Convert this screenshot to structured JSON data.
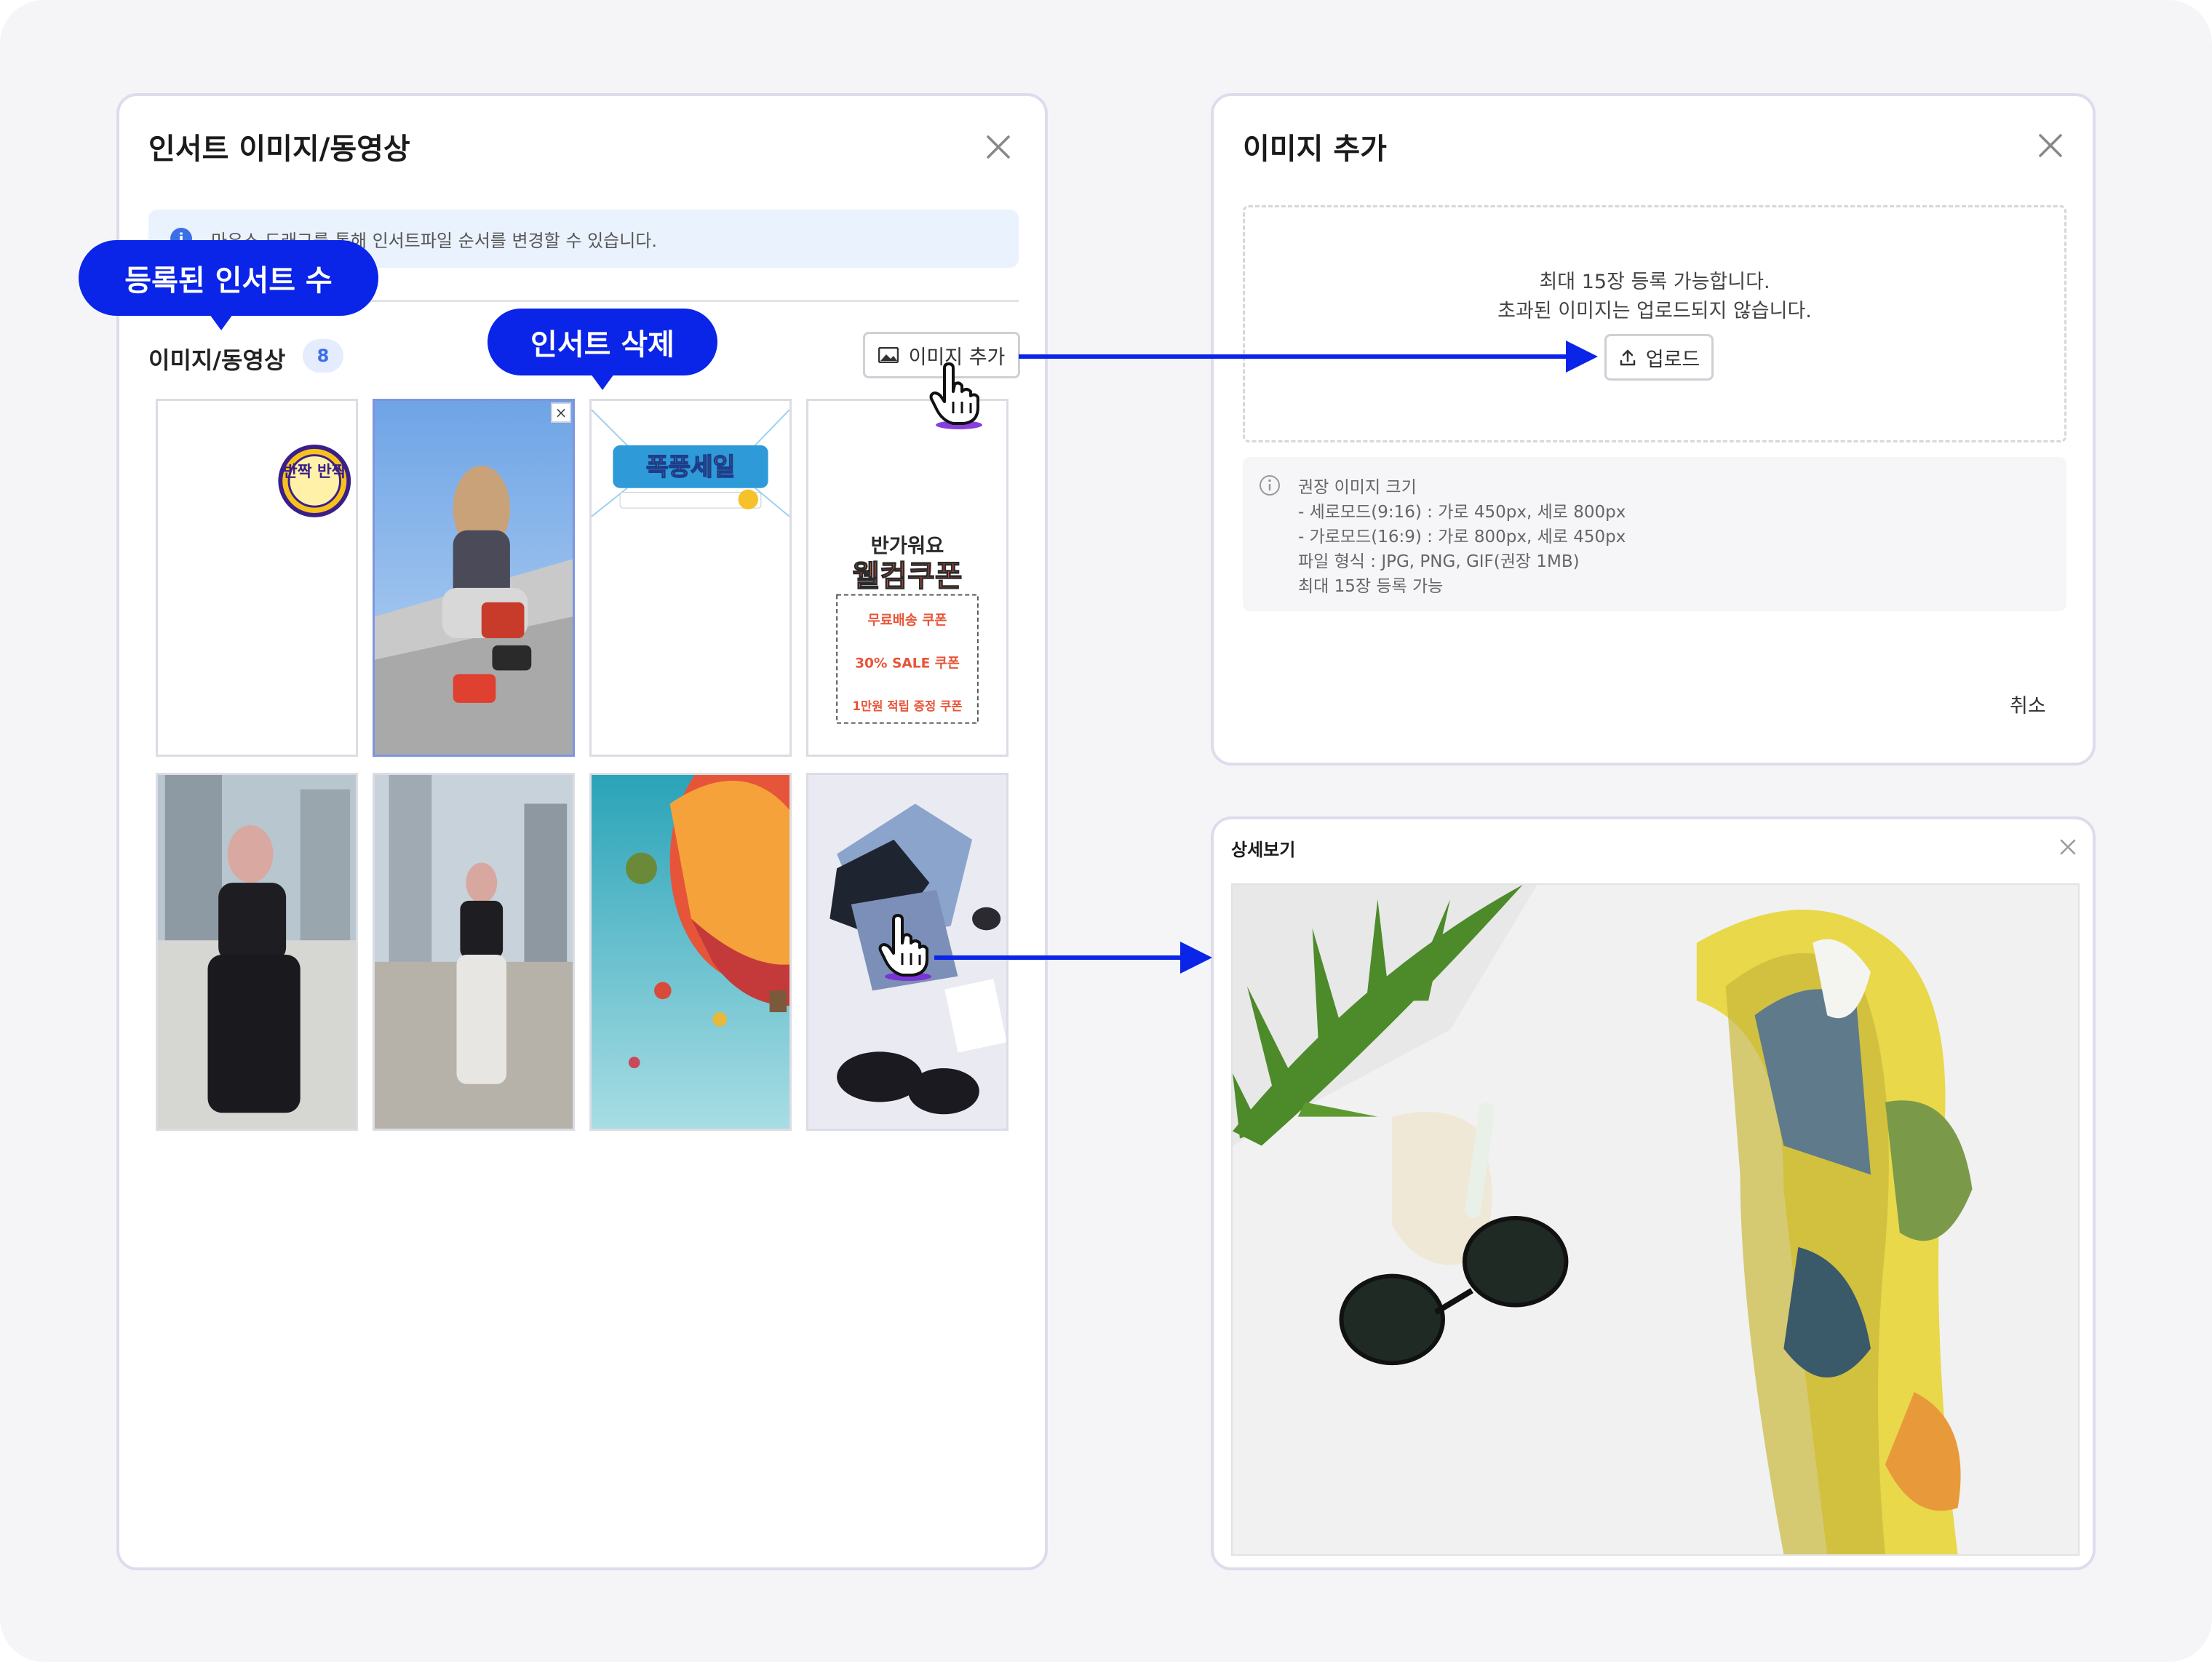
{
  "left_dialog": {
    "title": "인서트 이미지/동영상",
    "info_text": "마우스 드래그를 통해 인서트파일 순서를 변경할 수 있습니다.",
    "section_label": "이미지/동영상",
    "count": "8",
    "add_image_button": "이미지 추가",
    "close_icon": "close-icon",
    "thumbnails": [
      {
        "label": "반짝 반짝 sticker",
        "type": "graphic"
      },
      {
        "label": "fashion photo - woman on steps",
        "type": "photo",
        "selected": true,
        "delete_button": "×"
      },
      {
        "label": "폭풍세일 banner",
        "type": "graphic"
      },
      {
        "label": "반가워요 웰컴쿠폰 / 무료배송 쿠폰 / 30% SALE 쿠폰 / 1만원 적립 증정 쿠폰",
        "type": "graphic"
      },
      {
        "label": "fashion photo - black outfit",
        "type": "photo"
      },
      {
        "label": "fashion photo - street",
        "type": "photo"
      },
      {
        "label": "hot air balloons",
        "type": "photo"
      },
      {
        "label": "flat lay - clothes and shoes",
        "type": "photo"
      }
    ]
  },
  "thumb_texts": {
    "sticker": "반짝 반짝",
    "sale_banner": "폭풍세일",
    "coupon_top": "반가워요",
    "coupon_title": "웰컴쿠폰",
    "coupon_1": "무료배송 쿠폰",
    "coupon_2": "30% SALE 쿠폰",
    "coupon_3": "1만원 적립 증정 쿠폰"
  },
  "callouts": {
    "count_label": "등록된 인서트 수",
    "delete_label": "인서트 삭제"
  },
  "upload_dialog": {
    "title": "이미지 추가",
    "dropzone_line1": "최대 15장 등록 가능합니다.",
    "dropzone_line2": "초과된 이미지는 업로드되지 않습니다.",
    "upload_button": "업로드",
    "recommend_title": "권장 이미지 크기",
    "recommend_lines": [
      "- 세로모드(9:16) : 가로 450px, 세로 800px",
      "- 가로모드(16:9) : 가로 800px, 세로 450px",
      "파일 형식 : JPG, PNG, GIF(권장 1MB)",
      "최대 15장 등록 가능"
    ],
    "cancel_button": "취소"
  },
  "preview_dialog": {
    "title": "상세보기",
    "image_label": "scarf, sunglasses and palm leaf flat lay"
  },
  "colors": {
    "accent": "#0a24e8",
    "badge_bg": "#e4ecfd",
    "badge_text": "#3a6fe8",
    "info_bg": "#eaf3fd"
  }
}
